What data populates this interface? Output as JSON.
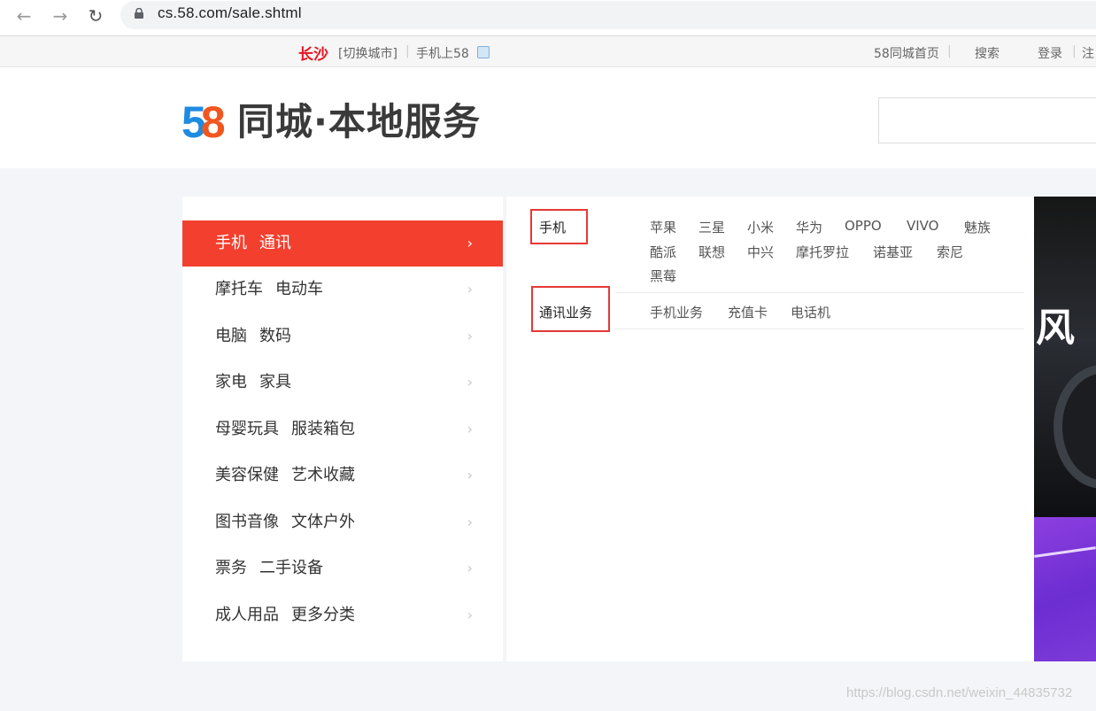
{
  "browser": {
    "url": "cs.58.com/sale.shtml"
  },
  "topbar": {
    "city": "长沙",
    "switch_city": "[切换城市]",
    "mobile": "手机上58",
    "home": "58同城首页",
    "search": "搜索",
    "login": "登录",
    "register": "注"
  },
  "header": {
    "logo_digits": [
      "5",
      "8"
    ],
    "logo_text": "同城·本地服务"
  },
  "categories": [
    {
      "a": "手机",
      "b": "通讯",
      "active": true
    },
    {
      "a": "摩托车",
      "b": "电动车",
      "active": false
    },
    {
      "a": "电脑",
      "b": "数码",
      "active": false
    },
    {
      "a": "家电",
      "b": "家具",
      "active": false
    },
    {
      "a": "母婴玩具",
      "b": "服装箱包",
      "active": false
    },
    {
      "a": "美容保健",
      "b": "艺术收藏",
      "active": false
    },
    {
      "a": "图书音像",
      "b": "文体户外",
      "active": false
    },
    {
      "a": "票务",
      "b": "二手设备",
      "active": false
    },
    {
      "a": "成人用品",
      "b": "更多分类",
      "active": false
    }
  ],
  "detail": {
    "groups": [
      {
        "title": "手机",
        "items": [
          "苹果",
          "三星",
          "小米",
          "华为",
          "OPPO",
          "VIVO",
          "魅族",
          "酷派",
          "联想",
          "中兴",
          "摩托罗拉",
          "诺基亚",
          "索尼",
          "黑莓"
        ]
      },
      {
        "title": "通讯业务",
        "items": [
          "手机业务",
          "充值卡",
          "电话机"
        ]
      }
    ]
  },
  "banner": {
    "char": "风"
  },
  "watermark": "https://blog.csdn.net/weixin_44835732"
}
